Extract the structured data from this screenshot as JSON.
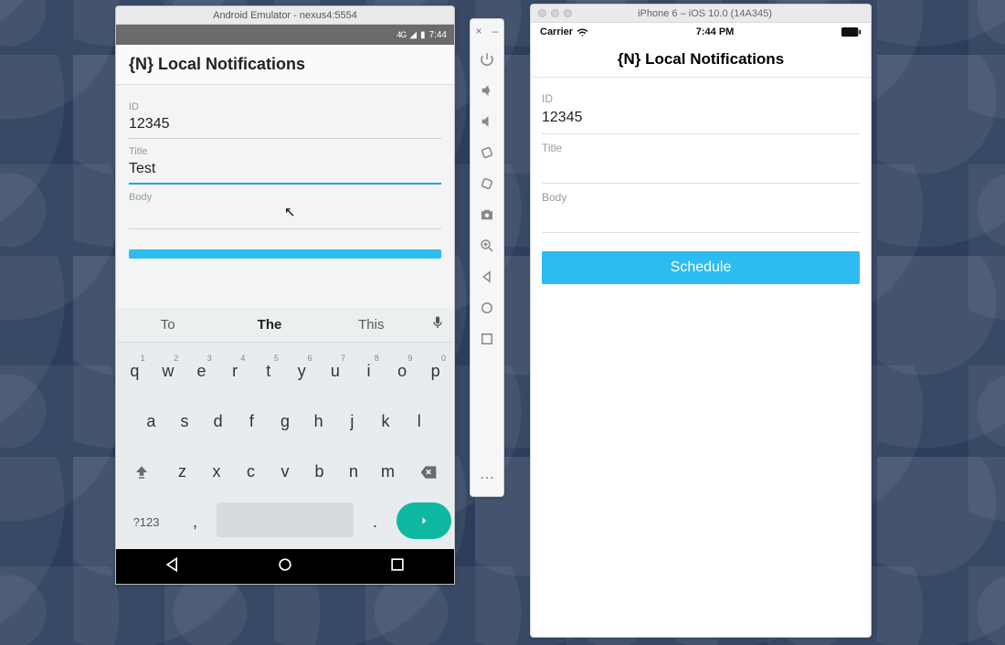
{
  "android": {
    "window_title": "Android Emulator - nexus4:5554",
    "status": {
      "network": "4G",
      "signal": "▲",
      "battery": "▮",
      "time": "7:44"
    },
    "actionbar_title": "{N} Local Notifications",
    "fields": {
      "id_label": "ID",
      "id_value": "12345",
      "title_label": "Title",
      "title_value": "Test",
      "body_label": "Body",
      "body_value": ""
    },
    "keyboard": {
      "suggestions": [
        "To",
        "The",
        "This"
      ],
      "row1": [
        {
          "k": "q",
          "d": "1"
        },
        {
          "k": "w",
          "d": "2"
        },
        {
          "k": "e",
          "d": "3"
        },
        {
          "k": "r",
          "d": "4"
        },
        {
          "k": "t",
          "d": "5"
        },
        {
          "k": "y",
          "d": "6"
        },
        {
          "k": "u",
          "d": "7"
        },
        {
          "k": "i",
          "d": "8"
        },
        {
          "k": "o",
          "d": "9"
        },
        {
          "k": "p",
          "d": "0"
        }
      ],
      "row2": [
        "a",
        "s",
        "d",
        "f",
        "g",
        "h",
        "j",
        "k",
        "l"
      ],
      "row3": [
        "z",
        "x",
        "c",
        "v",
        "b",
        "n",
        "m"
      ],
      "mode_label": "?123",
      "comma": ",",
      "period": "."
    }
  },
  "sidebar_tools": [
    "power",
    "volume-up",
    "volume-down",
    "rotate-left",
    "rotate-right",
    "camera",
    "zoom",
    "back",
    "home",
    "overview",
    "more"
  ],
  "ios": {
    "window_title": "iPhone 6 – iOS 10.0 (14A345)",
    "status": {
      "carrier": "Carrier",
      "time": "7:44 PM"
    },
    "nav_title": "{N} Local Notifications",
    "fields": {
      "id_label": "ID",
      "id_value": "12345",
      "title_label": "Title",
      "title_value": "",
      "body_label": "Body",
      "body_value": ""
    },
    "button_label": "Schedule"
  }
}
